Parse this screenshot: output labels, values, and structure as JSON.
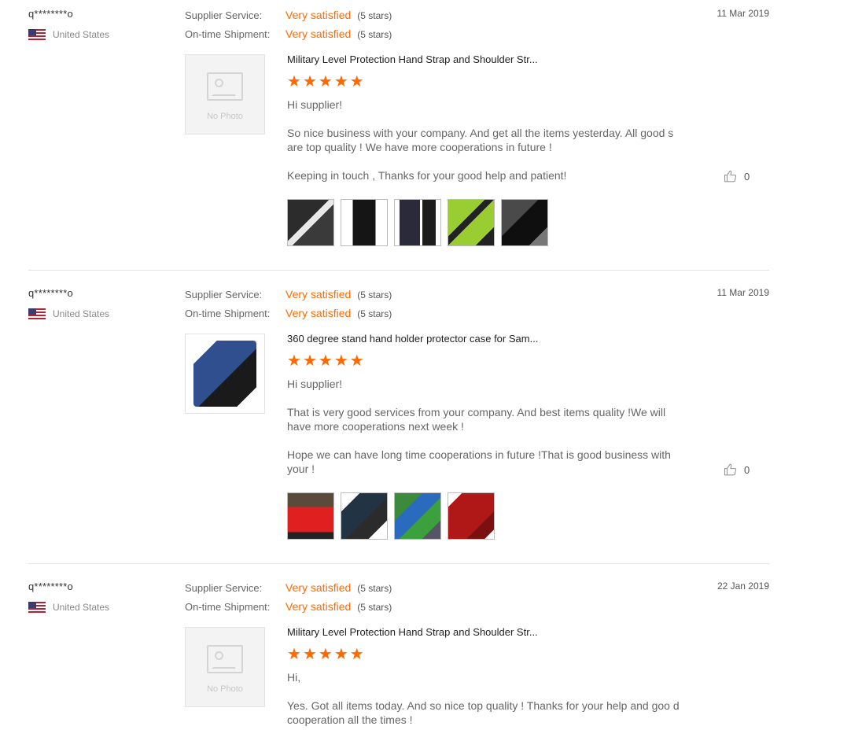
{
  "reviews": [
    {
      "buyer": "q********o",
      "country": "United States",
      "date": "11 Mar 2019",
      "supplier_service": {
        "label": "Supplier Service:",
        "value": "Very satisfied",
        "count": "(5 stars)"
      },
      "shipment": {
        "label": "On-time Shipment:",
        "value": "Very satisfied",
        "count": "(5 stars)"
      },
      "has_photo": false,
      "no_photo_text": "No Photo",
      "product": "Military Level Protection Hand Strap and Shoulder Str...",
      "rating": 5,
      "paragraphs": [
        "Hi supplier!",
        "So nice business with your company. And get all the items yesterday.  All good s are top quality ! We have more cooperations in future !",
        "Keeping in touch , Thanks for your good help and patient!"
      ],
      "likes": "0"
    },
    {
      "buyer": "q********o",
      "country": "United States",
      "date": "11 Mar 2019",
      "supplier_service": {
        "label": "Supplier Service:",
        "value": "Very satisfied",
        "count": "(5 stars)"
      },
      "shipment": {
        "label": "On-time Shipment:",
        "value": "Very satisfied",
        "count": "(5 stars)"
      },
      "has_photo": true,
      "product": "360 degree stand hand holder protector case for Sam...",
      "rating": 5,
      "paragraphs": [
        "Hi supplier!",
        "That is very good services from your company. And best items quality !We will have more cooperations next week !",
        "Hope we can have long time cooperations in future !That is good business with your !"
      ],
      "likes": "0"
    },
    {
      "buyer": "q********o",
      "country": "United States",
      "date": "22 Jan 2019",
      "supplier_service": {
        "label": "Supplier Service:",
        "value": "Very satisfied",
        "count": "(5 stars)"
      },
      "shipment": {
        "label": "On-time Shipment:",
        "value": "Very satisfied",
        "count": "(5 stars)"
      },
      "has_photo": false,
      "no_photo_text": "No Photo",
      "product": "Military Level Protection Hand Strap and Shoulder Str...",
      "rating": 5,
      "paragraphs": [
        "Hi,",
        "Yes. Got all items today. And so nice top quality ! Thanks for your help and goo d cooperation all the times !"
      ]
    }
  ],
  "colors": {
    "accent": "#ff6a00",
    "divider": "#e3e3e3"
  },
  "icons": {
    "flag": "us-flag-icon",
    "like": "thumbs-up-icon",
    "star": "star-icon",
    "no_photo": "image-placeholder-icon"
  }
}
